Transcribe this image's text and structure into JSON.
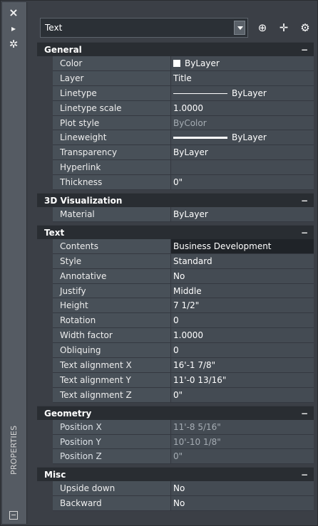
{
  "sidebar": {
    "close_icon": "×",
    "hide_icon": "▸",
    "settings_icon": "✲",
    "title": "PROPERTIES"
  },
  "toolbar": {
    "object_type": "Text",
    "quick_select_icon": "⊕",
    "pick_icon": "✛",
    "toggle_icon": "⚙"
  },
  "sections": {
    "general": {
      "title": "General",
      "collapse": "−",
      "rows": {
        "color": {
          "label": "Color",
          "value": "ByLayer"
        },
        "layer": {
          "label": "Layer",
          "value": "Title"
        },
        "linetype": {
          "label": "Linetype",
          "value": "ByLayer"
        },
        "linetype_scale": {
          "label": "Linetype scale",
          "value": "1.0000"
        },
        "plot_style": {
          "label": "Plot style",
          "value": "ByColor"
        },
        "lineweight": {
          "label": "Lineweight",
          "value": "ByLayer"
        },
        "transparency": {
          "label": "Transparency",
          "value": "ByLayer"
        },
        "hyperlink": {
          "label": "Hyperlink",
          "value": ""
        },
        "thickness": {
          "label": "Thickness",
          "value": "0\""
        }
      }
    },
    "visualization": {
      "title": "3D Visualization",
      "collapse": "−",
      "rows": {
        "material": {
          "label": "Material",
          "value": "ByLayer"
        }
      }
    },
    "text": {
      "title": "Text",
      "collapse": "−",
      "rows": {
        "contents": {
          "label": "Contents",
          "value": "Business Development"
        },
        "style": {
          "label": "Style",
          "value": "Standard"
        },
        "annotative": {
          "label": "Annotative",
          "value": "No"
        },
        "justify": {
          "label": "Justify",
          "value": "Middle"
        },
        "height": {
          "label": "Height",
          "value": "7 1/2\""
        },
        "rotation": {
          "label": "Rotation",
          "value": "0"
        },
        "width_factor": {
          "label": "Width factor",
          "value": "1.0000"
        },
        "obliquing": {
          "label": "Obliquing",
          "value": "0"
        },
        "align_x": {
          "label": "Text alignment X",
          "value": "16'-1 7/8\""
        },
        "align_y": {
          "label": "Text alignment Y",
          "value": "11'-0 13/16\""
        },
        "align_z": {
          "label": "Text alignment Z",
          "value": "0\""
        }
      }
    },
    "geometry": {
      "title": "Geometry",
      "collapse": "−",
      "rows": {
        "pos_x": {
          "label": "Position X",
          "value": "11'-8 5/16\""
        },
        "pos_y": {
          "label": "Position Y",
          "value": "10'-10 1/8\""
        },
        "pos_z": {
          "label": "Position Z",
          "value": "0\""
        }
      }
    },
    "misc": {
      "title": "Misc",
      "collapse": "−",
      "rows": {
        "upside_down": {
          "label": "Upside down",
          "value": "No"
        },
        "backward": {
          "label": "Backward",
          "value": "No"
        }
      }
    }
  }
}
